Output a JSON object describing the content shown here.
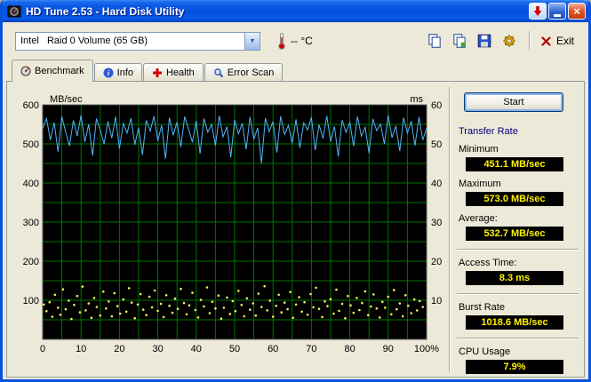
{
  "window": {
    "title": "HD Tune 2.53 - Hard Disk Utility"
  },
  "toolbar": {
    "drive_select": "Intel   Raid 0 Volume (65 GB)",
    "temperature": "-- °C",
    "exit_label": "Exit"
  },
  "tabs": [
    {
      "label": "Benchmark",
      "active": true
    },
    {
      "label": "Info",
      "active": false
    },
    {
      "label": "Health",
      "active": false
    },
    {
      "label": "Error Scan",
      "active": false
    }
  ],
  "benchmark": {
    "start_label": "Start",
    "results": {
      "section_title": "Transfer Rate",
      "minimum_label": "Minimum",
      "minimum_value": "451.1 MB/sec",
      "maximum_label": "Maximum",
      "maximum_value": "573.0 MB/sec",
      "average_label": "Average:",
      "average_value": "532.7 MB/sec",
      "access_time_label": "Access Time:",
      "access_time_value": "8.3 ms",
      "burst_rate_label": "Burst Rate",
      "burst_rate_value": "1018.6 MB/sec",
      "cpu_usage_label": "CPU Usage",
      "cpu_usage_value": "7.9%"
    }
  },
  "chart_data": {
    "type": "line",
    "title": "HD Tune benchmark graph",
    "left_axis": {
      "label": "MB/sec",
      "min": 0,
      "max": 600,
      "ticks": [
        600,
        500,
        400,
        300,
        200,
        100
      ]
    },
    "right_axis": {
      "label": "ms",
      "min": 0,
      "max": 60,
      "ticks": [
        60,
        50,
        40,
        30,
        20,
        10
      ]
    },
    "x_axis": {
      "min": 0,
      "max": 100,
      "tick_labels": [
        "0",
        "10",
        "20",
        "30",
        "40",
        "50",
        "60",
        "70",
        "80",
        "90",
        "100%"
      ]
    },
    "grid": {
      "color": "#007300",
      "x_step": 5,
      "y_step": 50,
      "background": "#000000"
    },
    "series": [
      {
        "name": "transfer_rate",
        "axis": "left",
        "unit": "MB/sec",
        "color": "#4FB6F7",
        "values": [
          540,
          565,
          510,
          555,
          480,
          570,
          530,
          495,
          560,
          520,
          573,
          505,
          550,
          470,
          565,
          535,
          500,
          558,
          515,
          570,
          488,
          552,
          528,
          566,
          498,
          542,
          472,
          560,
          533,
          571,
          508,
          548,
          462,
          567,
          522,
          556,
          492,
          570,
          538,
          504,
          559,
          475,
          565,
          530,
          550,
          496,
          572,
          518,
          544,
          466,
          562,
          526,
          553,
          486,
          569,
          512,
          541,
          451,
          566,
          532,
          557,
          478,
          571,
          524,
          547,
          502,
          563,
          490,
          554,
          536,
          568,
          484,
          549,
          514,
          572,
          506,
          545,
          468,
          561,
          529,
          555,
          494,
          570,
          520,
          543,
          476,
          564,
          534,
          551,
          500,
          573,
          516,
          546,
          482,
          567,
          528,
          558,
          496,
          569,
          510,
          540
        ]
      },
      {
        "name": "access_time",
        "axis": "right",
        "unit": "ms",
        "color": "#EFEF5A",
        "points": [
          [
            0.3,
            8.9
          ],
          [
            1,
            7.2
          ],
          [
            1.8,
            9.5
          ],
          [
            2.5,
            5.8
          ],
          [
            3.2,
            11.4
          ],
          [
            4,
            8.1
          ],
          [
            4.6,
            6.3
          ],
          [
            5.3,
            12.8
          ],
          [
            6,
            7.7
          ],
          [
            6.8,
            9.9
          ],
          [
            7.5,
            5.2
          ],
          [
            8.2,
            8.8
          ],
          [
            9,
            11.1
          ],
          [
            9.7,
            6.9
          ],
          [
            10.4,
            13.5
          ],
          [
            11.2,
            7.4
          ],
          [
            12,
            9.2
          ],
          [
            12.7,
            5.5
          ],
          [
            13.4,
            10.6
          ],
          [
            14.1,
            8.3
          ],
          [
            15,
            6.1
          ],
          [
            15.8,
            12.2
          ],
          [
            16.5,
            7.9
          ],
          [
            17.2,
            9.7
          ],
          [
            18,
            5.9
          ],
          [
            18.7,
            11.8
          ],
          [
            19.5,
            8.5
          ],
          [
            20.2,
            6.6
          ],
          [
            21,
            10.2
          ],
          [
            21.8,
            7.1
          ],
          [
            22.5,
            13.1
          ],
          [
            23.2,
            9.4
          ],
          [
            24,
            5.4
          ],
          [
            24.8,
            8.9
          ],
          [
            25.5,
            11.6
          ],
          [
            26.2,
            7.6
          ],
          [
            27,
            6.2
          ],
          [
            27.8,
            10.9
          ],
          [
            28.5,
            8.2
          ],
          [
            29.2,
            12.5
          ],
          [
            30,
            7.3
          ],
          [
            30.8,
            9.1
          ],
          [
            31.5,
            5.7
          ],
          [
            32.2,
            11.3
          ],
          [
            33,
            8.6
          ],
          [
            33.8,
            6.8
          ],
          [
            34.5,
            10.4
          ],
          [
            35.2,
            7.8
          ],
          [
            36,
            12.9
          ],
          [
            36.8,
            9.3
          ],
          [
            37.5,
            6.4
          ],
          [
            38.2,
            8.7
          ],
          [
            39,
            11.9
          ],
          [
            39.8,
            7.5
          ],
          [
            40.5,
            5.6
          ],
          [
            41.2,
            10.1
          ],
          [
            42,
            8.4
          ],
          [
            42.8,
            13.3
          ],
          [
            43.5,
            6.7
          ],
          [
            44.2,
            9.6
          ],
          [
            45,
            7.9
          ],
          [
            45.8,
            11.2
          ],
          [
            46.5,
            5.3
          ],
          [
            47.2,
            8.1
          ],
          [
            48,
            10.7
          ],
          [
            48.8,
            6.5
          ],
          [
            49.5,
            9.8
          ],
          [
            50.2,
            7.2
          ],
          [
            51,
            12.4
          ],
          [
            51.8,
            8.8
          ],
          [
            52.5,
            5.9
          ],
          [
            53.2,
            10.5
          ],
          [
            54,
            7.6
          ],
          [
            54.8,
            9.2
          ],
          [
            55.5,
            6.1
          ],
          [
            56.2,
            11.7
          ],
          [
            57,
            8.3
          ],
          [
            57.8,
            13.6
          ],
          [
            58.5,
            7.4
          ],
          [
            59.2,
            9.9
          ],
          [
            60,
            5.8
          ],
          [
            60.8,
            8.6
          ],
          [
            61.5,
            11.4
          ],
          [
            62.2,
            6.9
          ],
          [
            63,
            9.4
          ],
          [
            63.8,
            7.7
          ],
          [
            64.5,
            12.1
          ],
          [
            65.2,
            5.5
          ],
          [
            66,
            8.9
          ],
          [
            66.8,
            10.8
          ],
          [
            67.5,
            7.1
          ],
          [
            68.2,
            9.5
          ],
          [
            69,
            6.3
          ],
          [
            69.8,
            11.6
          ],
          [
            70.5,
            8.2
          ],
          [
            71.2,
            13.2
          ],
          [
            72,
            7.8
          ],
          [
            72.8,
            5.7
          ],
          [
            73.5,
            9.7
          ],
          [
            74.2,
            8.5
          ],
          [
            75,
            10.3
          ],
          [
            75.8,
            6.6
          ],
          [
            76.5,
            12.7
          ],
          [
            77.2,
            7.3
          ],
          [
            78,
            9.1
          ],
          [
            78.8,
            5.4
          ],
          [
            79.5,
            11.1
          ],
          [
            80.2,
            8.7
          ],
          [
            81,
            6.8
          ],
          [
            81.8,
            10.6
          ],
          [
            82.5,
            7.5
          ],
          [
            83.2,
            9.3
          ],
          [
            84,
            12.3
          ],
          [
            84.8,
            6.2
          ],
          [
            85.5,
            8.4
          ],
          [
            86.2,
            11.5
          ],
          [
            87,
            7.9
          ],
          [
            87.8,
            5.6
          ],
          [
            88.5,
            9.6
          ],
          [
            89.2,
            8.1
          ],
          [
            90,
            10.9
          ],
          [
            90.8,
            6.4
          ],
          [
            91.5,
            12.6
          ],
          [
            92.2,
            7.7
          ],
          [
            93,
            9.2
          ],
          [
            93.8,
            5.9
          ],
          [
            94.5,
            11.3
          ],
          [
            95.2,
            8.6
          ],
          [
            96,
            6.7
          ],
          [
            96.8,
            10.2
          ],
          [
            97.5,
            7.4
          ],
          [
            98.2,
            9.8
          ],
          [
            99,
            8.3
          ]
        ]
      }
    ]
  }
}
